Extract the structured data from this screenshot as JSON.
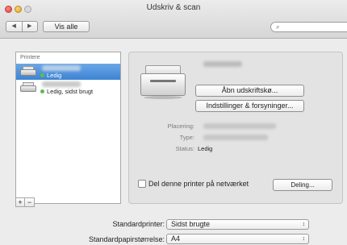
{
  "window": {
    "title": "Udskriv & scan"
  },
  "toolbar": {
    "back": "◀",
    "forward": "▶",
    "show_all": "Vis alle",
    "search_placeholder": ""
  },
  "printers": {
    "header": "Printere",
    "items": [
      {
        "status": "Ledig",
        "selected": true
      },
      {
        "status": "Ledig, sidst brugt",
        "selected": false
      }
    ],
    "add": "+",
    "remove": "−"
  },
  "detail": {
    "open_queue": "Åbn udskriftskø...",
    "settings": "Indstillinger & forsyninger...",
    "labels": {
      "location": "Placering:",
      "type": "Type:",
      "status": "Status:"
    },
    "status_value": "Ledig",
    "share_label": "Del denne printer på netværket",
    "share_button": "Deling..."
  },
  "defaults": {
    "printer_label": "Standardprinter:",
    "printer_value": "Sidst brugte",
    "paper_label": "Standardpapirstørrelse:",
    "paper_value": "A4"
  },
  "colors": {
    "selection": "#3d83d4",
    "status_dot": "#5cbe4a"
  }
}
